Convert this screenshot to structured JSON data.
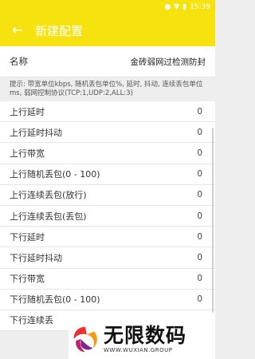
{
  "status_bar": {
    "time": "15:39",
    "icons": [
      "location-icon",
      "wifi-icon",
      "battery-icon"
    ]
  },
  "app_bar": {
    "back_icon": "←",
    "title": "新建配置"
  },
  "name_field": {
    "label": "名称",
    "value": "金砖弱网过检测防封"
  },
  "hint": "提示: 带宽单位kbps, 随机丢包单位%, 延时, 抖动, 连续丢包单位ms, 弱网控制协议(TCP:1,UDP:2,ALL:3)",
  "rows": [
    {
      "label": "上行延时",
      "value": "0"
    },
    {
      "label": "上行延时抖动",
      "value": "0"
    },
    {
      "label": "上行带宽",
      "value": "0"
    },
    {
      "label": "上行随机丢包(0 - 100)",
      "value": "0"
    },
    {
      "label": "上行连续丢包(放行)",
      "value": "0"
    },
    {
      "label": "上行连续丢包(丢包)",
      "value": "0"
    },
    {
      "label": "下行延时",
      "value": "0"
    },
    {
      "label": "下行延时抖动",
      "value": "0"
    },
    {
      "label": "下行带宽",
      "value": "0"
    },
    {
      "label": "下行随机丢包(0 - 100)",
      "value": "0"
    },
    {
      "label": "下行连续丢",
      "value": ""
    }
  ],
  "watermark": {
    "main": "无限数码",
    "sub": "WWW.WUXIAN.GROUP"
  },
  "colors": {
    "accent": "#f5e20f",
    "background": "#eeeeee"
  }
}
